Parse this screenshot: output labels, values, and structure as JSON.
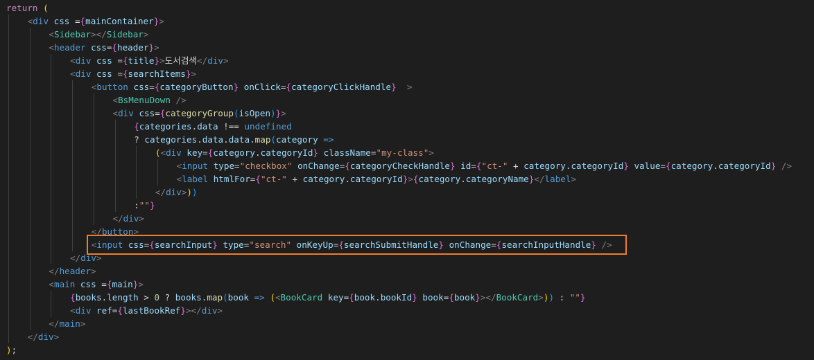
{
  "editor": {
    "background": "#1e1e1e",
    "accent_highlight": "#ee7d2d",
    "lines": [
      {
        "indent": 0,
        "tokens": [
          [
            "return",
            "ctl"
          ],
          [
            " ",
            "tx"
          ],
          [
            "(",
            "br1"
          ]
        ]
      },
      {
        "indent": 1,
        "tokens": [
          [
            "<",
            "p"
          ],
          [
            "div",
            "kw"
          ],
          [
            " ",
            "tx"
          ],
          [
            "css",
            "at"
          ],
          [
            " =",
            "tx"
          ],
          [
            "{",
            "br2"
          ],
          [
            "mainContainer",
            "at"
          ],
          [
            "}",
            "br2"
          ],
          [
            ">",
            "p"
          ]
        ]
      },
      {
        "indent": 2,
        "tokens": [
          [
            "<",
            "p"
          ],
          [
            "Sidebar",
            "tag"
          ],
          [
            "></",
            "p"
          ],
          [
            "Sidebar",
            "tag"
          ],
          [
            ">",
            "p"
          ]
        ]
      },
      {
        "indent": 2,
        "tokens": [
          [
            "<",
            "p"
          ],
          [
            "header",
            "kw"
          ],
          [
            " ",
            "tx"
          ],
          [
            "css",
            "at"
          ],
          [
            "=",
            "tx"
          ],
          [
            "{",
            "br2"
          ],
          [
            "header",
            "at"
          ],
          [
            "}",
            "br2"
          ],
          [
            ">",
            "p"
          ]
        ]
      },
      {
        "indent": 3,
        "tokens": [
          [
            "<",
            "p"
          ],
          [
            "div",
            "kw"
          ],
          [
            " ",
            "tx"
          ],
          [
            "css",
            "at"
          ],
          [
            " =",
            "tx"
          ],
          [
            "{",
            "br2"
          ],
          [
            "title",
            "at"
          ],
          [
            "}",
            "br2"
          ],
          [
            ">",
            "p"
          ],
          [
            "도서검색",
            "tx"
          ],
          [
            "</",
            "p"
          ],
          [
            "div",
            "kw"
          ],
          [
            ">",
            "p"
          ]
        ]
      },
      {
        "indent": 3,
        "tokens": [
          [
            "<",
            "p"
          ],
          [
            "div",
            "kw"
          ],
          [
            " ",
            "tx"
          ],
          [
            "css",
            "at"
          ],
          [
            " =",
            "tx"
          ],
          [
            "{",
            "br2"
          ],
          [
            "searchItems",
            "at"
          ],
          [
            "}",
            "br2"
          ],
          [
            ">",
            "p"
          ]
        ]
      },
      {
        "indent": 4,
        "tokens": [
          [
            "<",
            "p"
          ],
          [
            "button",
            "kw"
          ],
          [
            " ",
            "tx"
          ],
          [
            "css",
            "at"
          ],
          [
            "=",
            "tx"
          ],
          [
            "{",
            "br2"
          ],
          [
            "categoryButton",
            "at"
          ],
          [
            "}",
            "br2"
          ],
          [
            " ",
            "tx"
          ],
          [
            "onClick",
            "at"
          ],
          [
            "=",
            "tx"
          ],
          [
            "{",
            "br2"
          ],
          [
            "categoryClickHandle",
            "at"
          ],
          [
            "}",
            "br2"
          ],
          [
            "  ",
            "tx"
          ],
          [
            ">",
            "p"
          ]
        ]
      },
      {
        "indent": 5,
        "tokens": [
          [
            "<",
            "p"
          ],
          [
            "BsMenuDown",
            "tag"
          ],
          [
            " />",
            "p"
          ]
        ]
      },
      {
        "indent": 5,
        "tokens": [
          [
            "<",
            "p"
          ],
          [
            "div",
            "kw"
          ],
          [
            " ",
            "tx"
          ],
          [
            "css",
            "at"
          ],
          [
            "=",
            "tx"
          ],
          [
            "{",
            "br2"
          ],
          [
            "categoryGroup",
            "fn"
          ],
          [
            "(",
            "br3"
          ],
          [
            "isOpen",
            "at"
          ],
          [
            ")",
            "br3"
          ],
          [
            "}",
            "br2"
          ],
          [
            ">",
            "p"
          ]
        ]
      },
      {
        "indent": 6,
        "tokens": [
          [
            "{",
            "br2"
          ],
          [
            "categories",
            "at"
          ],
          [
            ".",
            "tx"
          ],
          [
            "data",
            "at"
          ],
          [
            " !== ",
            "tx"
          ],
          [
            "undefined",
            "kw"
          ]
        ]
      },
      {
        "indent": 6,
        "tokens": [
          [
            "? ",
            "tx"
          ],
          [
            "categories",
            "at"
          ],
          [
            ".",
            "tx"
          ],
          [
            "data",
            "at"
          ],
          [
            ".",
            "tx"
          ],
          [
            "data",
            "at"
          ],
          [
            ".",
            "tx"
          ],
          [
            "map",
            "fn"
          ],
          [
            "(",
            "br3"
          ],
          [
            "category",
            "at"
          ],
          [
            " ",
            "tx"
          ],
          [
            "=>",
            "kw"
          ]
        ]
      },
      {
        "indent": 7,
        "tokens": [
          [
            "(",
            "br1"
          ],
          [
            "<",
            "p"
          ],
          [
            "div",
            "kw"
          ],
          [
            " ",
            "tx"
          ],
          [
            "key",
            "at"
          ],
          [
            "=",
            "tx"
          ],
          [
            "{",
            "br2"
          ],
          [
            "category",
            "at"
          ],
          [
            ".",
            "tx"
          ],
          [
            "categoryId",
            "at"
          ],
          [
            "}",
            "br2"
          ],
          [
            " ",
            "tx"
          ],
          [
            "className",
            "at"
          ],
          [
            "=",
            "tx"
          ],
          [
            "\"my-class\"",
            "st"
          ],
          [
            ">",
            "p"
          ]
        ]
      },
      {
        "indent": 8,
        "tokens": [
          [
            "<",
            "p"
          ],
          [
            "input",
            "kw"
          ],
          [
            " ",
            "tx"
          ],
          [
            "type",
            "at"
          ],
          [
            "=",
            "tx"
          ],
          [
            "\"checkbox\"",
            "st"
          ],
          [
            " ",
            "tx"
          ],
          [
            "onChange",
            "at"
          ],
          [
            "=",
            "tx"
          ],
          [
            "{",
            "br2"
          ],
          [
            "categoryCheckHandle",
            "at"
          ],
          [
            "}",
            "br2"
          ],
          [
            " ",
            "tx"
          ],
          [
            "id",
            "at"
          ],
          [
            "=",
            "tx"
          ],
          [
            "{",
            "br2"
          ],
          [
            "\"ct-\"",
            "st"
          ],
          [
            " + ",
            "tx"
          ],
          [
            "category",
            "at"
          ],
          [
            ".",
            "tx"
          ],
          [
            "categoryId",
            "at"
          ],
          [
            "}",
            "br2"
          ],
          [
            " ",
            "tx"
          ],
          [
            "value",
            "at"
          ],
          [
            "=",
            "tx"
          ],
          [
            "{",
            "br2"
          ],
          [
            "category",
            "at"
          ],
          [
            ".",
            "tx"
          ],
          [
            "categoryId",
            "at"
          ],
          [
            "}",
            "br2"
          ],
          [
            " />",
            "p"
          ]
        ]
      },
      {
        "indent": 8,
        "tokens": [
          [
            "<",
            "p"
          ],
          [
            "label",
            "kw"
          ],
          [
            " ",
            "tx"
          ],
          [
            "htmlFor",
            "at"
          ],
          [
            "=",
            "tx"
          ],
          [
            "{",
            "br2"
          ],
          [
            "\"ct-\"",
            "st"
          ],
          [
            " + ",
            "tx"
          ],
          [
            "category",
            "at"
          ],
          [
            ".",
            "tx"
          ],
          [
            "categoryId",
            "at"
          ],
          [
            "}",
            "br2"
          ],
          [
            ">",
            "p"
          ],
          [
            "{",
            "br2"
          ],
          [
            "category",
            "at"
          ],
          [
            ".",
            "tx"
          ],
          [
            "categoryName",
            "at"
          ],
          [
            "}",
            "br2"
          ],
          [
            "</",
            "p"
          ],
          [
            "label",
            "kw"
          ],
          [
            ">",
            "p"
          ]
        ]
      },
      {
        "indent": 7,
        "tokens": [
          [
            "</",
            "p"
          ],
          [
            "div",
            "kw"
          ],
          [
            ">",
            "p"
          ],
          [
            ")",
            "br1"
          ],
          [
            ")",
            "br3"
          ]
        ]
      },
      {
        "indent": 6,
        "tokens": [
          [
            ":",
            "tx"
          ],
          [
            "\"\"",
            "st"
          ],
          [
            "}",
            "br2"
          ]
        ]
      },
      {
        "indent": 5,
        "tokens": [
          [
            "</",
            "p"
          ],
          [
            "div",
            "kw"
          ],
          [
            ">",
            "p"
          ]
        ]
      },
      {
        "indent": 4,
        "tokens": [
          [
            "</",
            "p"
          ],
          [
            "button",
            "kw"
          ],
          [
            ">",
            "p"
          ]
        ]
      },
      {
        "indent": 4,
        "tokens": [
          [
            "<",
            "p"
          ],
          [
            "input",
            "kw"
          ],
          [
            " ",
            "tx"
          ],
          [
            "css",
            "at"
          ],
          [
            "=",
            "tx"
          ],
          [
            "{",
            "br2"
          ],
          [
            "searchInput",
            "at"
          ],
          [
            "}",
            "br2"
          ],
          [
            " ",
            "tx"
          ],
          [
            "type",
            "at"
          ],
          [
            "=",
            "tx"
          ],
          [
            "\"search\"",
            "st"
          ],
          [
            " ",
            "tx"
          ],
          [
            "onKeyUp",
            "at"
          ],
          [
            "=",
            "tx"
          ],
          [
            "{",
            "br2"
          ],
          [
            "searchSubmitHandle",
            "at"
          ],
          [
            "}",
            "br2"
          ],
          [
            " ",
            "tx"
          ],
          [
            "onChange",
            "at"
          ],
          [
            "=",
            "tx"
          ],
          [
            "{",
            "br2"
          ],
          [
            "searchInputHandle",
            "at"
          ],
          [
            "}",
            "br2"
          ],
          [
            " />",
            "p"
          ]
        ]
      },
      {
        "indent": 3,
        "tokens": [
          [
            "</",
            "p"
          ],
          [
            "div",
            "kw"
          ],
          [
            ">",
            "p"
          ]
        ]
      },
      {
        "indent": 2,
        "tokens": [
          [
            "</",
            "p"
          ],
          [
            "header",
            "kw"
          ],
          [
            ">",
            "p"
          ]
        ]
      },
      {
        "indent": 2,
        "tokens": [
          [
            "<",
            "p"
          ],
          [
            "main",
            "kw"
          ],
          [
            " ",
            "tx"
          ],
          [
            "css",
            "at"
          ],
          [
            " =",
            "tx"
          ],
          [
            "{",
            "br2"
          ],
          [
            "main",
            "at"
          ],
          [
            "}",
            "br2"
          ],
          [
            ">",
            "p"
          ]
        ]
      },
      {
        "indent": 3,
        "tokens": [
          [
            "{",
            "br2"
          ],
          [
            "books",
            "at"
          ],
          [
            ".",
            "tx"
          ],
          [
            "length",
            "at"
          ],
          [
            " > ",
            "tx"
          ],
          [
            "0",
            "num"
          ],
          [
            " ? ",
            "tx"
          ],
          [
            "books",
            "at"
          ],
          [
            ".",
            "tx"
          ],
          [
            "map",
            "fn"
          ],
          [
            "(",
            "br3"
          ],
          [
            "book",
            "at"
          ],
          [
            " ",
            "tx"
          ],
          [
            "=>",
            "kw"
          ],
          [
            " ",
            "tx"
          ],
          [
            "(",
            "br1"
          ],
          [
            "<",
            "p"
          ],
          [
            "BookCard",
            "tag"
          ],
          [
            " ",
            "tx"
          ],
          [
            "key",
            "at"
          ],
          [
            "=",
            "tx"
          ],
          [
            "{",
            "br2"
          ],
          [
            "book",
            "at"
          ],
          [
            ".",
            "tx"
          ],
          [
            "bookId",
            "at"
          ],
          [
            "}",
            "br2"
          ],
          [
            " ",
            "tx"
          ],
          [
            "book",
            "at"
          ],
          [
            "=",
            "tx"
          ],
          [
            "{",
            "br2"
          ],
          [
            "book",
            "at"
          ],
          [
            "}",
            "br2"
          ],
          [
            "></",
            "p"
          ],
          [
            "BookCard",
            "tag"
          ],
          [
            ">",
            "p"
          ],
          [
            ")",
            "br1"
          ],
          [
            ")",
            "br3"
          ],
          [
            " : ",
            "tx"
          ],
          [
            "\"\"",
            "st"
          ],
          [
            "}",
            "br2"
          ]
        ]
      },
      {
        "indent": 3,
        "tokens": [
          [
            "<",
            "p"
          ],
          [
            "div",
            "kw"
          ],
          [
            " ",
            "tx"
          ],
          [
            "ref",
            "at"
          ],
          [
            "=",
            "tx"
          ],
          [
            "{",
            "br2"
          ],
          [
            "lastBookRef",
            "at"
          ],
          [
            "}",
            "br2"
          ],
          [
            "></",
            "p"
          ],
          [
            "div",
            "kw"
          ],
          [
            ">",
            "p"
          ]
        ]
      },
      {
        "indent": 2,
        "tokens": [
          [
            "</",
            "p"
          ],
          [
            "main",
            "kw"
          ],
          [
            ">",
            "p"
          ]
        ]
      },
      {
        "indent": 1,
        "tokens": [
          [
            "</",
            "p"
          ],
          [
            "div",
            "kw"
          ],
          [
            ">",
            "p"
          ]
        ]
      },
      {
        "indent": 0,
        "tokens": [
          [
            ")",
            "br1"
          ],
          [
            ";",
            "tx"
          ]
        ]
      }
    ],
    "highlighted_line": 18
  }
}
